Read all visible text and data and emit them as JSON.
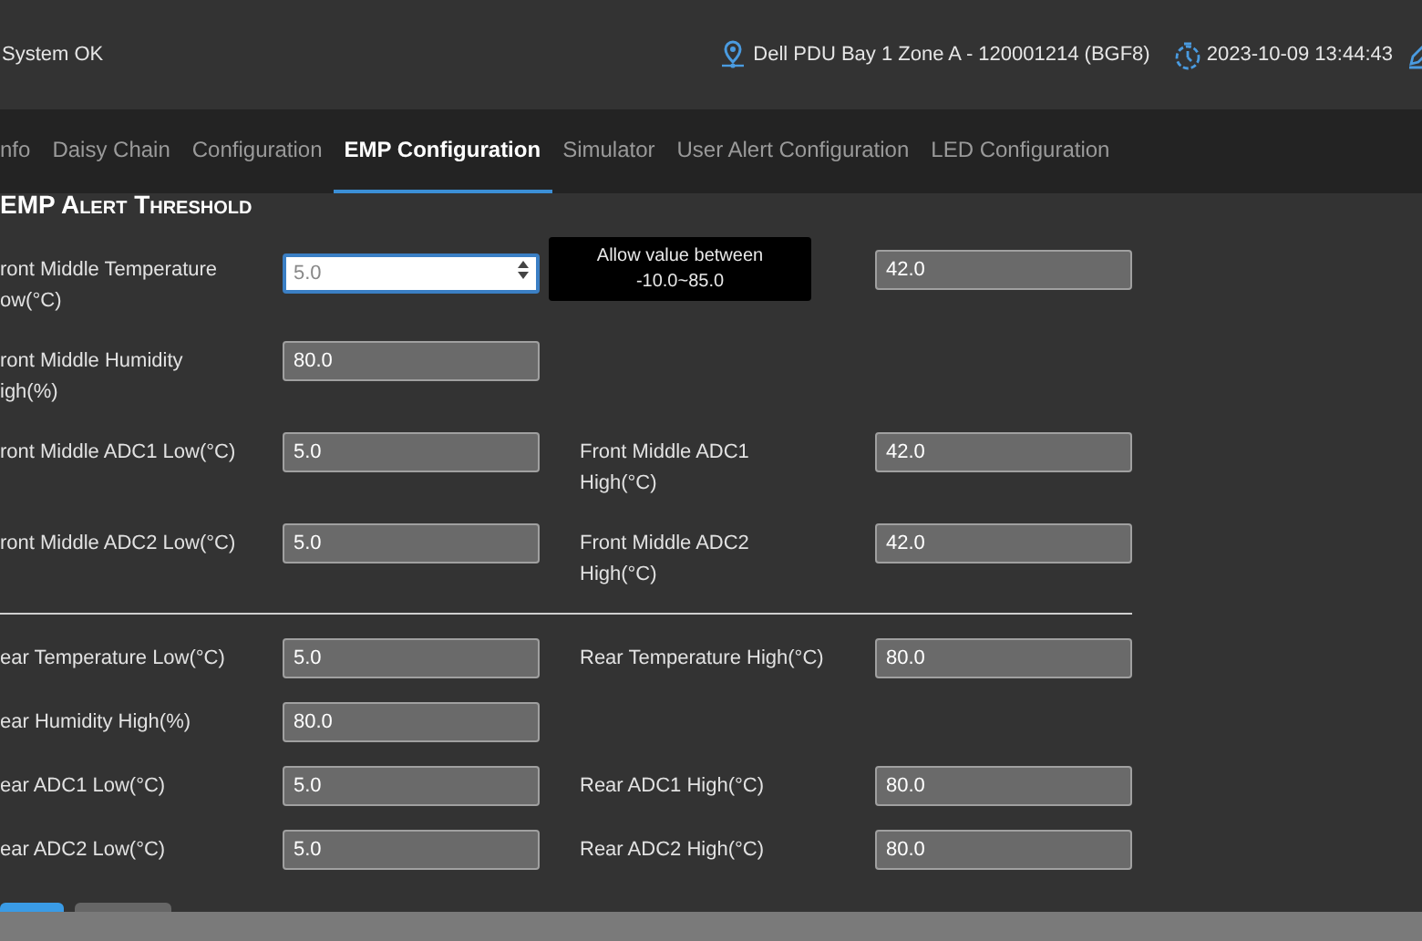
{
  "header": {
    "status": "System OK",
    "location": "Dell PDU Bay 1 Zone A - 120001214 (BGF8)",
    "datetime": "2023-10-09 13:44:43"
  },
  "tabs": [
    {
      "label": "nfo",
      "selected": false
    },
    {
      "label": "Daisy Chain",
      "selected": false
    },
    {
      "label": "Configuration",
      "selected": false
    },
    {
      "label": "EMP Configuration",
      "selected": true
    },
    {
      "label": "Simulator",
      "selected": false
    },
    {
      "label": "User Alert Configuration",
      "selected": false
    },
    {
      "label": "LED Configuration",
      "selected": false
    }
  ],
  "section_title": "EMP Alert Threshold",
  "sections": [
    {
      "rows": [
        {
          "left": {
            "label_lines": [
              "ront Middle Temperature",
              "ow(°C)"
            ],
            "value": "5.0",
            "focused": true
          },
          "right": {
            "value": "42.0",
            "focused": false
          }
        },
        {
          "left": {
            "label_lines": [
              "ront Middle Humidity",
              "igh(%)"
            ],
            "value": "80.0",
            "focused": false
          }
        },
        {
          "left": {
            "label_lines": [
              "ront Middle ADC1 Low(°C)"
            ],
            "value": "5.0",
            "focused": false
          },
          "right": {
            "label_lines": [
              "Front Middle ADC1",
              "High(°C)"
            ],
            "value": "42.0",
            "focused": false
          }
        },
        {
          "left": {
            "label_lines": [
              "ront Middle ADC2 Low(°C)"
            ],
            "value": "5.0",
            "focused": false
          },
          "right": {
            "label_lines": [
              "Front Middle ADC2",
              "High(°C)"
            ],
            "value": "42.0",
            "focused": false
          }
        }
      ]
    },
    {
      "rows": [
        {
          "left": {
            "label_lines": [
              "ear Temperature Low(°C)"
            ],
            "value": "5.0",
            "focused": false
          },
          "right": {
            "label_lines": [
              "Rear Temperature High(°C)"
            ],
            "value": "80.0",
            "focused": false
          }
        },
        {
          "left": {
            "label_lines": [
              "ear Humidity High(%)"
            ],
            "value": "80.0",
            "focused": false
          }
        },
        {
          "left": {
            "label_lines": [
              "ear ADC1 Low(°C)"
            ],
            "value": "5.0",
            "focused": false
          },
          "right": {
            "label_lines": [
              "Rear ADC1 High(°C)"
            ],
            "value": "80.0",
            "focused": false
          }
        },
        {
          "left": {
            "label_lines": [
              "ear ADC2 Low(°C)"
            ],
            "value": "5.0",
            "focused": false
          },
          "right": {
            "label_lines": [
              "Rear ADC2 High(°C)"
            ],
            "value": "80.0",
            "focused": false
          }
        }
      ]
    }
  ],
  "tooltip": {
    "lines": [
      "Allow value between",
      "-10.0~85.0"
    ]
  }
}
